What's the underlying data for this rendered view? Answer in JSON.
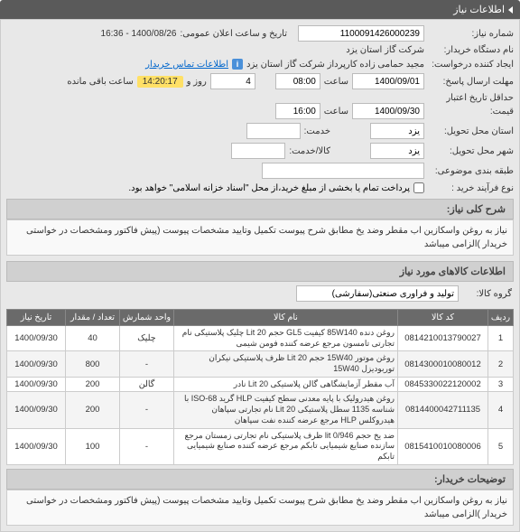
{
  "panel": {
    "title": "اطلاعات نیاز"
  },
  "fields": {
    "req_no_label": "شماره نیاز:",
    "req_no": "1100091426000239",
    "announce_label": "تاریخ و ساعت اعلان عمومی:",
    "announce_value": "1400/08/26 - 16:36",
    "buyer_org_label": "نام دستگاه خریدار:",
    "buyer_org": "شرکت گاز استان یزد",
    "creator_label": "ایجاد کننده درخواست:",
    "creator": "مجید حمامی زاده کارپرداز شرکت گاز استان یزد",
    "contact_link": "اطلاعات تماس خریدار",
    "reply_deadline_label": "مهلت ارسال پاسخ:",
    "reply_deadline_date": "1400/09/01",
    "time_label": "ساعت",
    "reply_deadline_time": "08:00",
    "days_label": "روز و",
    "days_value": "4",
    "remaining_label": "ساعت باقی مانده",
    "timer": "14:20:17",
    "credit_label": "حداقل تاریخ اعتبار",
    "price_label": "قیمت:",
    "credit_date": "1400/09/30",
    "credit_time": "16:00",
    "province_label": "استان محل تحویل:",
    "province": "یزد",
    "service_label": "خدمت:",
    "city_label": "شهر محل تحویل:",
    "city": "یزد",
    "goods_service_label": "کالا/خدمت:",
    "multi_label": "طبقه بندی موضوعی:",
    "buy_type_label": "نوع فرآیند خرید :",
    "pay_note": "پرداخت تمام یا بخشی از مبلغ خرید،از محل \"اسناد خزانه اسلامی\" خواهد بود."
  },
  "sections": {
    "desc_title": "شرح کلی نیاز:",
    "desc_text": "نیاز به روغن واسکازین اب مقطر وضد یخ مطابق شرح پیوست تکمیل وتایید مشخصات پیوست (پیش فاکتور ومشخصات در خواستی خریدار )الزامی میباشد",
    "items_title": "اطلاعات کالاهای مورد نیاز",
    "group_label": "گروه کالا:",
    "group_value": "تولید و فرآوری صنعتی(سفارشی)",
    "notes_title": "توضیحات خریدار:",
    "notes_text": "نیاز به روغن واسکازین اب مقطر وضد یخ مطابق شرح پیوست تکمیل وتایید مشخصات پیوست (پیش فاکتور ومشخصات در خواستی خریدار )الزامی میباشد"
  },
  "table": {
    "headers": {
      "row": "ردیف",
      "code": "کد کالا",
      "name": "نام کالا",
      "unit": "واحد شمارش",
      "qty": "تعداد / مقدار",
      "date": "تاریخ نیاز"
    },
    "rows": [
      {
        "n": "1",
        "code": "0814210013790027",
        "name": "روغن دنده 85W140 کیفیت GL5 حجم Lit 20 چلیک پلاستیکی نام تجارتی تامسون مرجع عرضه کننده فومن شیمی",
        "unit": "چلیک",
        "qty": "40",
        "date": "1400/09/30"
      },
      {
        "n": "2",
        "code": "0814300010080012",
        "name": "روغن موتور 15W40 حجم 20 Lit ظرف پلاستیکی نیکران توربودیزل 15W40",
        "unit": "-",
        "qty": "800",
        "date": "1400/09/30"
      },
      {
        "n": "3",
        "code": "0845330022120002",
        "name": "آب مقطر آزمایشگاهی گالن پلاستیکی 20 Lit نادر",
        "unit": "گالن",
        "qty": "200",
        "date": "1400/09/30"
      },
      {
        "n": "4",
        "code": "0814400042711135",
        "name": "روغن هیدرولیک با پایه معدنی سطح کیفیت HLP گرید ISO-68 با شناسه 1135 سطل پلاستیکی Lit 20 نام تجارتی سپاهان هیدروکلس HLP مرجع عرضه کننده نفت سپاهان",
        "unit": "-",
        "qty": "200",
        "date": "1400/09/30"
      },
      {
        "n": "5",
        "code": "0815410010080006",
        "name": "ضد یخ حجم lit 0/946 ظرف پلاستیکی نام تجارتی زمستان مرجع سازنده صنایع شیمیایی تابکم مرجع عرضه کننده صنایع شیمیایی تابکم",
        "unit": "-",
        "qty": "100",
        "date": "1400/09/30"
      }
    ]
  }
}
